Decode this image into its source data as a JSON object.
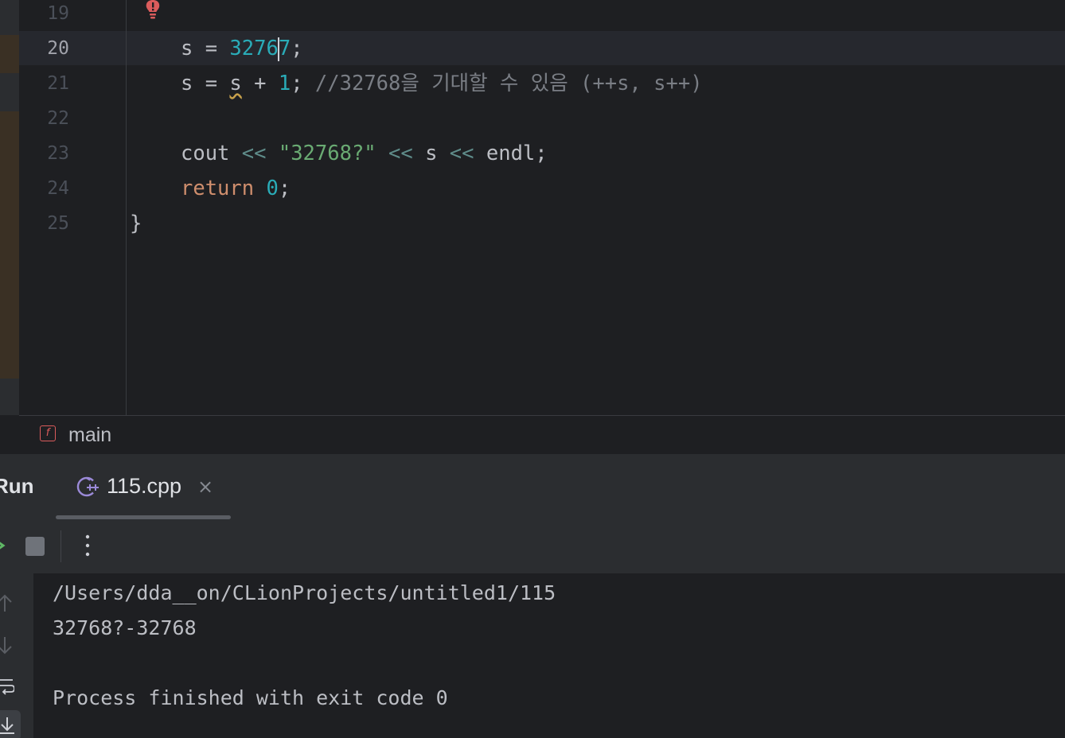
{
  "editor": {
    "line_numbers": [
      "19",
      "20",
      "21",
      "22",
      "23",
      "24",
      "25"
    ],
    "active_line": "20",
    "lines": {
      "l20": {
        "var": "s",
        "eq": " = ",
        "num_a": "3276",
        "num_b": "7",
        "end": ";"
      },
      "l21": {
        "var": "s",
        "eq": " = ",
        "warn_var": "s",
        "plus": " + ",
        "num": "1",
        "semi": "; ",
        "comment": "//32768을 기대할 수 있음 (++s, s++)"
      },
      "l23": {
        "cout": "cout",
        "op1": " << ",
        "str": "\"32768?\"",
        "op2": " << ",
        "s": "s",
        "op3": " << ",
        "endl": "endl;"
      },
      "l24": {
        "kw": "return",
        "sp": " ",
        "num": "0",
        "semi": ";"
      },
      "l25": {
        "brace": "}"
      }
    }
  },
  "breadcrumb": {
    "icon_letter": "f",
    "label": "main"
  },
  "run_panel": {
    "title": "Run",
    "tab": {
      "label": "115.cpp",
      "close": "×",
      "icon": "cpp-file-icon"
    },
    "toolbar": {
      "more": "⋮"
    },
    "console_lines": [
      "/Users/dda__on/CLionProjects/untitled1/115",
      "32768?-32768",
      "",
      "Process finished with exit code 0"
    ]
  },
  "colors": {
    "number": "#2aacb8",
    "keyword": "#cf8e6d",
    "string": "#6aab73",
    "comment": "#7a7e85",
    "background": "#1e1f22"
  }
}
